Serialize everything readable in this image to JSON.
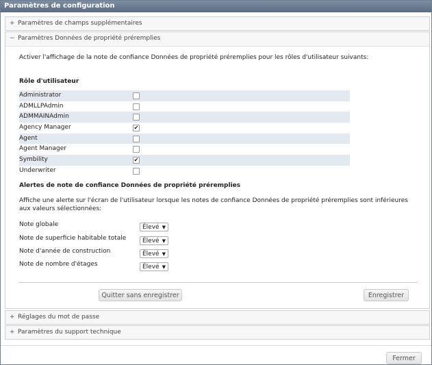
{
  "window": {
    "title": "Paramètres de configuration"
  },
  "panels": {
    "extra_fields": {
      "sign": "+",
      "title": "Paramètres de champs supplémentaires"
    },
    "prefill": {
      "sign": "−",
      "title": "Paramètres Données de propriété préremplies",
      "description": "Activer l'affichage de la note de confiance Données de propriété préremplies pour les rôles d'utilisateur suivants:",
      "roles_heading": "Rôle d'utilisateur",
      "roles": [
        {
          "label": "Administrator",
          "checked": false
        },
        {
          "label": "ADMLLPAdmin",
          "checked": false
        },
        {
          "label": "ADMMAINAdmin",
          "checked": false
        },
        {
          "label": "Agency Manager",
          "checked": true
        },
        {
          "label": "Agent",
          "checked": false
        },
        {
          "label": "Agent Manager",
          "checked": false
        },
        {
          "label": "Symbility",
          "checked": true
        },
        {
          "label": "Underwriter",
          "checked": false
        }
      ],
      "check_mark": "✔",
      "alerts_heading": "Alertes de note de confiance Données de propriété préremplies",
      "alerts_description": "Affiche une alerte sur l'écran de l'utilisateur lorsque les notes de confiance Données de propriété préremplies sont inférieures aux valeurs sélectionnées:",
      "alerts": [
        {
          "label": "Note globale",
          "value": "Élevé"
        },
        {
          "label": "Note de superficie habitable totale",
          "value": "Élevé"
        },
        {
          "label": "Note d'année de construction",
          "value": "Élevé"
        },
        {
          "label": "Note de nombre d'étages",
          "value": "Élevé"
        }
      ],
      "quit_button": "Quitter sans enregistrer",
      "save_button": "Enregistrer"
    },
    "password": {
      "sign": "+",
      "title": "Réglages du mot de passe"
    },
    "support": {
      "sign": "+",
      "title": "Paramètres du support technique"
    }
  },
  "footer": {
    "close_button": "Fermer"
  }
}
